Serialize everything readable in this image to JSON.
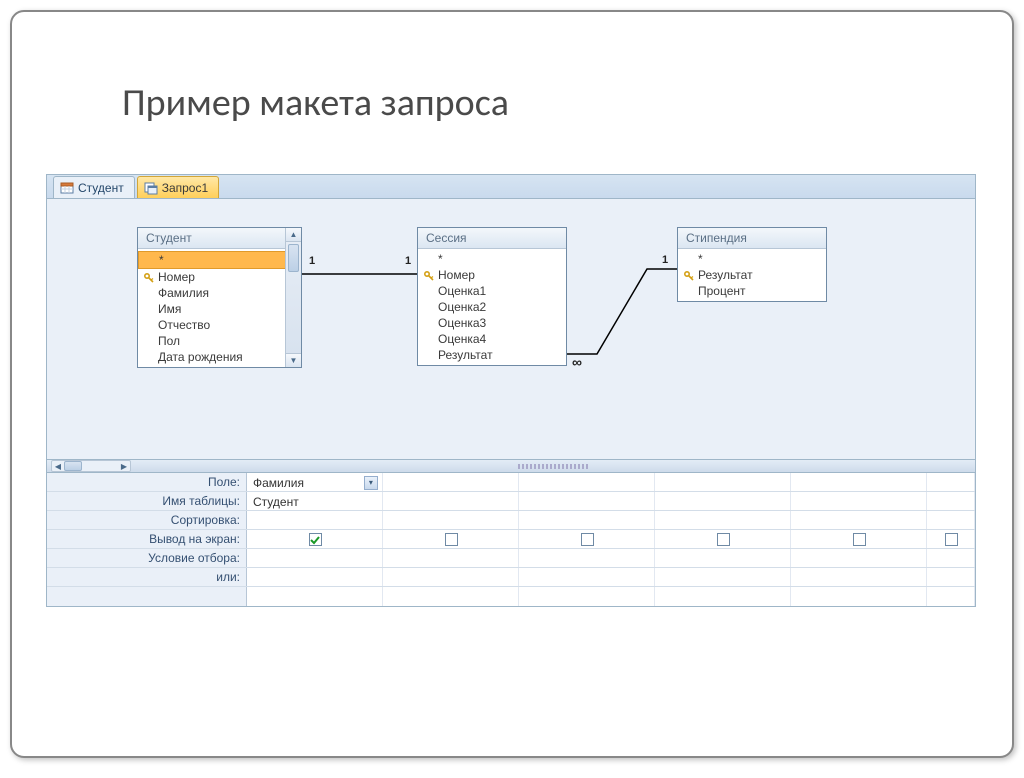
{
  "slide": {
    "title": "Пример макета запроса"
  },
  "tabs": [
    {
      "label": "Студент",
      "active": false
    },
    {
      "label": "Запрос1",
      "active": true
    }
  ],
  "tables": {
    "student": {
      "title": "Студент",
      "star": "*",
      "fields": [
        "Номер",
        "Фамилия",
        "Имя",
        "Отчество",
        "Пол",
        "Дата рождения"
      ]
    },
    "session": {
      "title": "Сессия",
      "star": "*",
      "fields": [
        "Номер",
        "Оценка1",
        "Оценка2",
        "Оценка3",
        "Оценка4",
        "Результат"
      ]
    },
    "stipend": {
      "title": "Стипендия",
      "star": "*",
      "fields": [
        "Результат",
        "Процент"
      ]
    }
  },
  "relations": {
    "r1": {
      "left": "1",
      "right": "1"
    },
    "r2": {
      "left": "∞",
      "right": "1"
    }
  },
  "grid": {
    "labels": {
      "field": "Поле:",
      "table": "Имя таблицы:",
      "sort": "Сортировка:",
      "show": "Вывод на экран:",
      "criteria": "Условие отбора:",
      "or": "или:"
    },
    "col1": {
      "field": "Фамилия",
      "table": "Студент"
    }
  }
}
